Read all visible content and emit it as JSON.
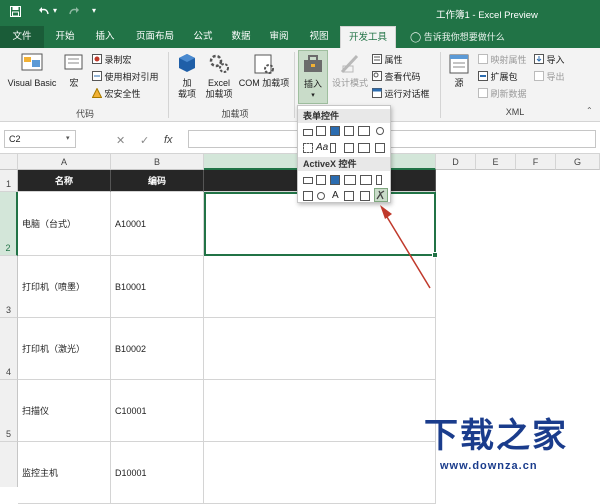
{
  "window": {
    "title": "工作簿1 - Excel Preview"
  },
  "quick_access": {
    "save_icon": "save-icon",
    "undo_icon": "undo-icon",
    "undo_dropdown": "▾",
    "customize": "▾"
  },
  "tabs": [
    {
      "label": "文件"
    },
    {
      "label": "开始"
    },
    {
      "label": "插入"
    },
    {
      "label": "页面布局"
    },
    {
      "label": "公式"
    },
    {
      "label": "数据"
    },
    {
      "label": "审阅"
    },
    {
      "label": "视图"
    },
    {
      "label": "开发工具"
    }
  ],
  "tell_me": {
    "placeholder": "告诉我你想要做什么"
  },
  "ribbon": {
    "code": {
      "visual_basic": "Visual Basic",
      "macros": "宏",
      "record_macro": "录制宏",
      "relative_refs": "使用相对引用",
      "macro_security": "宏安全性",
      "group_label": "代码"
    },
    "addins": {
      "addins": "加\n载项",
      "excel_addins": "Excel\n加载项",
      "com_addins": "COM 加载项",
      "group_label": "加载项"
    },
    "controls": {
      "insert": "插入",
      "design_mode": "设计模式",
      "properties": "属性",
      "view_code": "查看代码",
      "run_dialog": "运行对话框"
    },
    "xml": {
      "source": "源",
      "map_properties": "映射属性",
      "expansion_packs": "扩展包",
      "refresh_data": "刷新数据",
      "import": "导入",
      "export": "导出",
      "group_label": "XML"
    }
  },
  "formula_bar": {
    "name_box": "C2",
    "cancel": "✕",
    "enter": "✓",
    "fx": "fx",
    "value": ""
  },
  "columns": [
    "A",
    "B",
    "C",
    "D",
    "E",
    "F",
    "G"
  ],
  "rows": [
    "1",
    "2",
    "3",
    "4",
    "5"
  ],
  "table": {
    "headers": [
      "名称",
      "编码"
    ],
    "data": [
      [
        "电脑（台式）",
        "A10001"
      ],
      [
        "打印机（喷墨）",
        "B10001"
      ],
      [
        "打印机（激光）",
        "B10002"
      ],
      [
        "扫描仪",
        "C10001"
      ],
      [
        "监控主机",
        "D10001"
      ]
    ]
  },
  "dropdown": {
    "form_controls_title": "表单控件",
    "activex_title": "ActiveX 控件",
    "form_controls": [
      "button",
      "combo-box",
      "check-box",
      "spin-button",
      "list-box",
      "option-button",
      "group-box",
      "label",
      "scroll-bar",
      "text-field",
      "combo-list-edit",
      "combo-drop-down"
    ],
    "activex_controls": [
      "command-button",
      "combo-box",
      "check-box",
      "list-box",
      "text-box",
      "scroll-bar",
      "spin-button",
      "option-button",
      "label",
      "image",
      "toggle-button",
      "more-controls"
    ],
    "aa_label": "Aa",
    "a_label": "A"
  },
  "watermark": {
    "text": "下载之家",
    "url": "www.downza.cn"
  },
  "colors": {
    "excel_green": "#217346",
    "header_fill": "#262626",
    "arrow_red": "#c0392b",
    "watermark_blue": "#1a3c8c"
  }
}
